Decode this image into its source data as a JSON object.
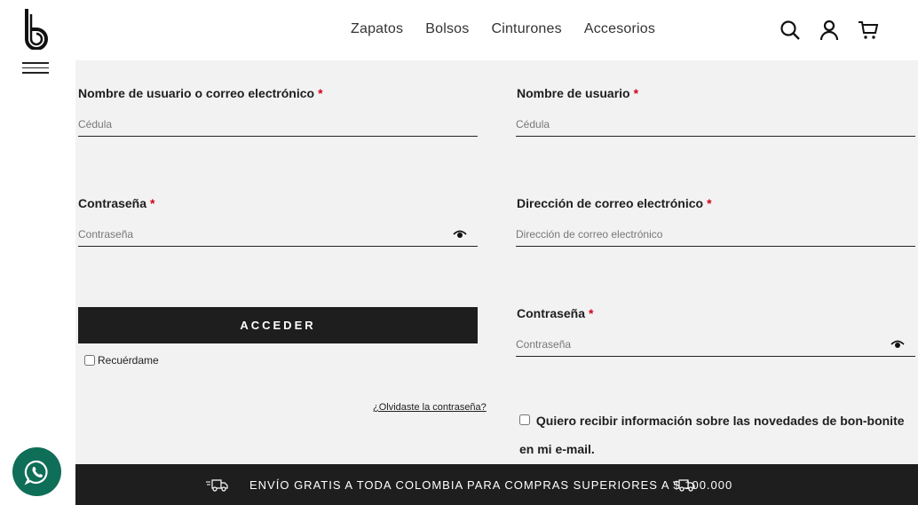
{
  "nav": {
    "items": [
      "Zapatos",
      "Bolsos",
      "Cinturones",
      "Accesorios"
    ]
  },
  "header_icons": [
    "search-icon",
    "user-icon",
    "cart-icon"
  ],
  "login": {
    "username_label": "Nombre de usuario o correo electrónico",
    "username_placeholder": "Cédula",
    "password_label": "Contraseña",
    "password_placeholder": "Contraseña",
    "submit_label": "ACCEDER",
    "remember_label": "Recuérdame",
    "forgot_label": "¿Olvidaste la contraseña?"
  },
  "register": {
    "username_label": "Nombre de usuario",
    "username_placeholder": "Cédula",
    "email_label": "Dirección de correo electrónico",
    "email_placeholder": "Dirección de correo electrónico",
    "password_label": "Contraseña",
    "password_placeholder": "Contraseña",
    "newsletter_label": "Quiero recibir información sobre las novedades de bon-bonite en mi e-mail."
  },
  "required_mark": "*",
  "footer_bar": {
    "text": "ENVÍO GRATIS A TODA COLOMBIA PARA COMPRAS SUPERIORES A $ 100.000"
  },
  "colors": {
    "background": "#f2f2f2",
    "dark": "#1e1e1e",
    "required": "#d0021b",
    "whatsapp": "#0f6e57"
  }
}
